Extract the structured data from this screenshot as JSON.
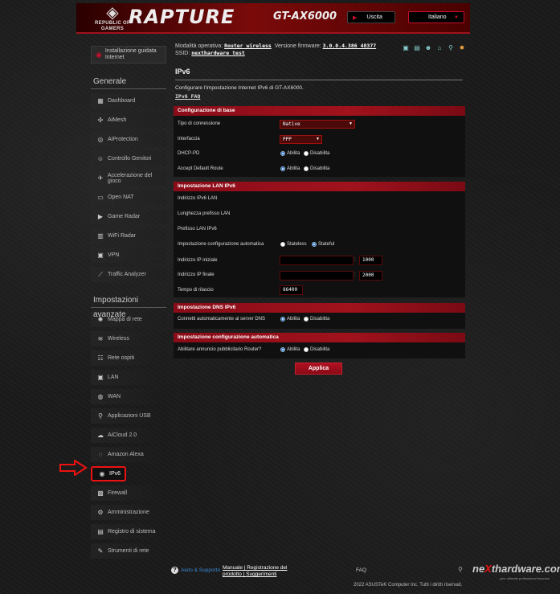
{
  "header": {
    "logo_line1": "REPUBLIC OF",
    "logo_line2": "GAMERS",
    "brand": "RAPTURE",
    "model": "GT-AX6000",
    "logout_label": "Uscita",
    "language": "Italiano"
  },
  "sidebar": {
    "quick_setup": "Installazione guidata Internet",
    "general_title": "Generale",
    "general_items": [
      {
        "label": "Dashboard",
        "icon": "dashboard-icon"
      },
      {
        "label": "AiMesh",
        "icon": "aimesh-icon"
      },
      {
        "label": "AiProtection",
        "icon": "aiprotection-icon"
      },
      {
        "label": "Controllo Genitori",
        "icon": "parental-icon"
      },
      {
        "label": "Accelerazione del gioco",
        "icon": "game-boost-icon"
      },
      {
        "label": "Open NAT",
        "icon": "open-nat-icon"
      },
      {
        "label": "Game Radar",
        "icon": "game-radar-icon"
      },
      {
        "label": "WiFi Radar",
        "icon": "wifi-radar-icon"
      },
      {
        "label": "VPN",
        "icon": "vpn-icon"
      },
      {
        "label": "Traffic Analyzer",
        "icon": "traffic-analyzer-icon"
      }
    ],
    "advanced_title": "Impostazioni avanzate",
    "advanced_items": [
      {
        "label": "Mappa di rete",
        "icon": "network-map-icon"
      },
      {
        "label": "Wireless",
        "icon": "wireless-icon"
      },
      {
        "label": "Rete ospiti",
        "icon": "guest-network-icon"
      },
      {
        "label": "LAN",
        "icon": "lan-icon"
      },
      {
        "label": "WAN",
        "icon": "wan-icon"
      },
      {
        "label": "Applicazioni USB",
        "icon": "usb-icon"
      },
      {
        "label": "AiCloud 2.0",
        "icon": "aicloud-icon"
      },
      {
        "label": "Amazon Alexa",
        "icon": "alexa-icon"
      },
      {
        "label": "IPv6",
        "icon": "ipv6-icon"
      },
      {
        "label": "Firewall",
        "icon": "firewall-icon"
      },
      {
        "label": "Amministrazione",
        "icon": "admin-icon"
      },
      {
        "label": "Registro di sistema",
        "icon": "system-log-icon"
      },
      {
        "label": "Strumenti di rete",
        "icon": "network-tools-icon"
      }
    ]
  },
  "status": {
    "mode_label": "Modalità operativa:",
    "mode_value": "Router wireless",
    "firmware_label": "Versione firmware:",
    "firmware_value": "3.0.0.4.386_48377",
    "ssid_label": "SSID:",
    "ssid_value": "nexthardware_test"
  },
  "main": {
    "title": "IPv6",
    "description": "Configurare l'impostazione Internet IPv6 di GT-AX6000.",
    "faq_link": "IPv6 FAQ",
    "basic": {
      "header": "Configurazione di base",
      "conn_type_label": "Tipo di connessione",
      "conn_type_value": "Native",
      "interface_label": "Interfaccia",
      "interface_value": "PPP",
      "dhcppd_label": "DHCP-PD",
      "accept_route_label": "Accept Default Route",
      "enable": "Abilita",
      "disable": "Disabilita"
    },
    "lan": {
      "header": "Impostazione LAN IPv6",
      "lan_addr_label": "Indirizzo IPv6 LAN",
      "prefix_len_label": "Lunghezza prefisso LAN",
      "prefix_label": "Prefisso LAN IPv6",
      "autoconf_label": "Impostazione configurazione automatica",
      "stateless": "Stateless",
      "stateful": "Stateful",
      "start_ip_label": "Indirizzo IP iniziale",
      "start_ip_suffix": "1000",
      "end_ip_label": "Indirizzo IP finale",
      "end_ip_suffix": "2000",
      "lease_label": "Tempo di rilascio",
      "lease_value": "86400"
    },
    "dns": {
      "header": "Impostazione DNS IPv6",
      "auto_dns_label": "Connetti automaticamente al server DNS"
    },
    "auto": {
      "header": "Impostazione configurazione automatica",
      "ra_label": "Abilitare annuncio pubblicitario Router?"
    },
    "apply": "Applica"
  },
  "footer": {
    "help": "Aiuto & Supporto",
    "manual": "Manuale",
    "registration": "Registrazione del",
    "product": "prodotto",
    "suggestions": "Suggerimenti",
    "faq": "FAQ",
    "copyright": "2022 ASUSTeK Computer Inc. Tutti i diritti riservati.",
    "watermark_a": "ne",
    "watermark_x": "X",
    "watermark_b": "thardware.com",
    "watermark_sub": "your ultimate professional resource"
  },
  "colors": {
    "accent": "#a0121c",
    "selected_radio": "#2a6fd6"
  }
}
